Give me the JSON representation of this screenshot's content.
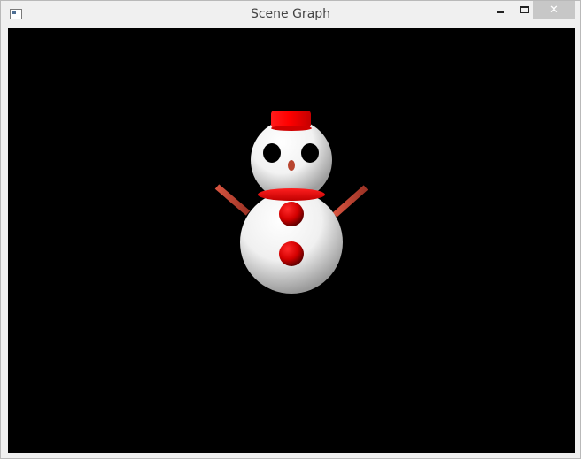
{
  "window": {
    "title": "Scene Graph",
    "close_glyph": "✕"
  },
  "icons": {
    "app": "app-window-icon",
    "minimize": "minimize-icon",
    "maximize": "maximize-icon",
    "close": "close-icon"
  },
  "scene": {
    "background": "#000000",
    "colors": {
      "snow": "#ffffff",
      "red": "#e00000",
      "eye": "#000000",
      "arm": "#cc4b37",
      "nose": "#b8452f"
    }
  }
}
